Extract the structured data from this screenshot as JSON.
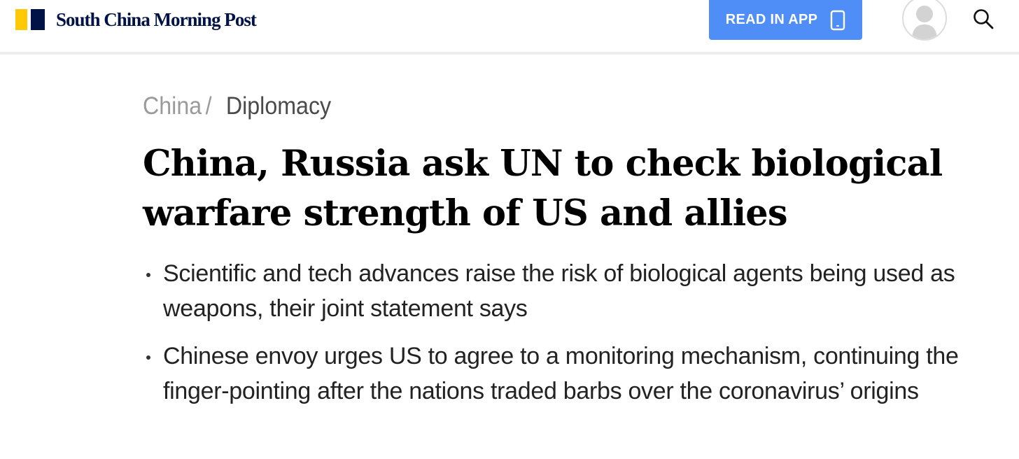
{
  "header": {
    "logo_text": "South China Morning Post",
    "brand_colors": {
      "yellow": "#FFCA05",
      "navy": "#001246"
    },
    "read_in_app_label": "READ IN APP",
    "read_in_app_color": "#4F8DF7",
    "icons": [
      "phone-icon",
      "avatar-icon",
      "search-icon"
    ]
  },
  "breadcrumb": {
    "parent": "China",
    "separator": "/",
    "current": "Diplomacy"
  },
  "article": {
    "headline": "China, Russia ask UN to check biological warfare strength of US and allies",
    "summary": [
      "Scientific and tech advances raise the risk of biological agents being used as weapons, their joint statement says",
      "Chinese envoy urges US to agree to a monitoring mechanism, continuing the finger-pointing after the nations traded barbs over the coronavirus’ origins"
    ]
  }
}
